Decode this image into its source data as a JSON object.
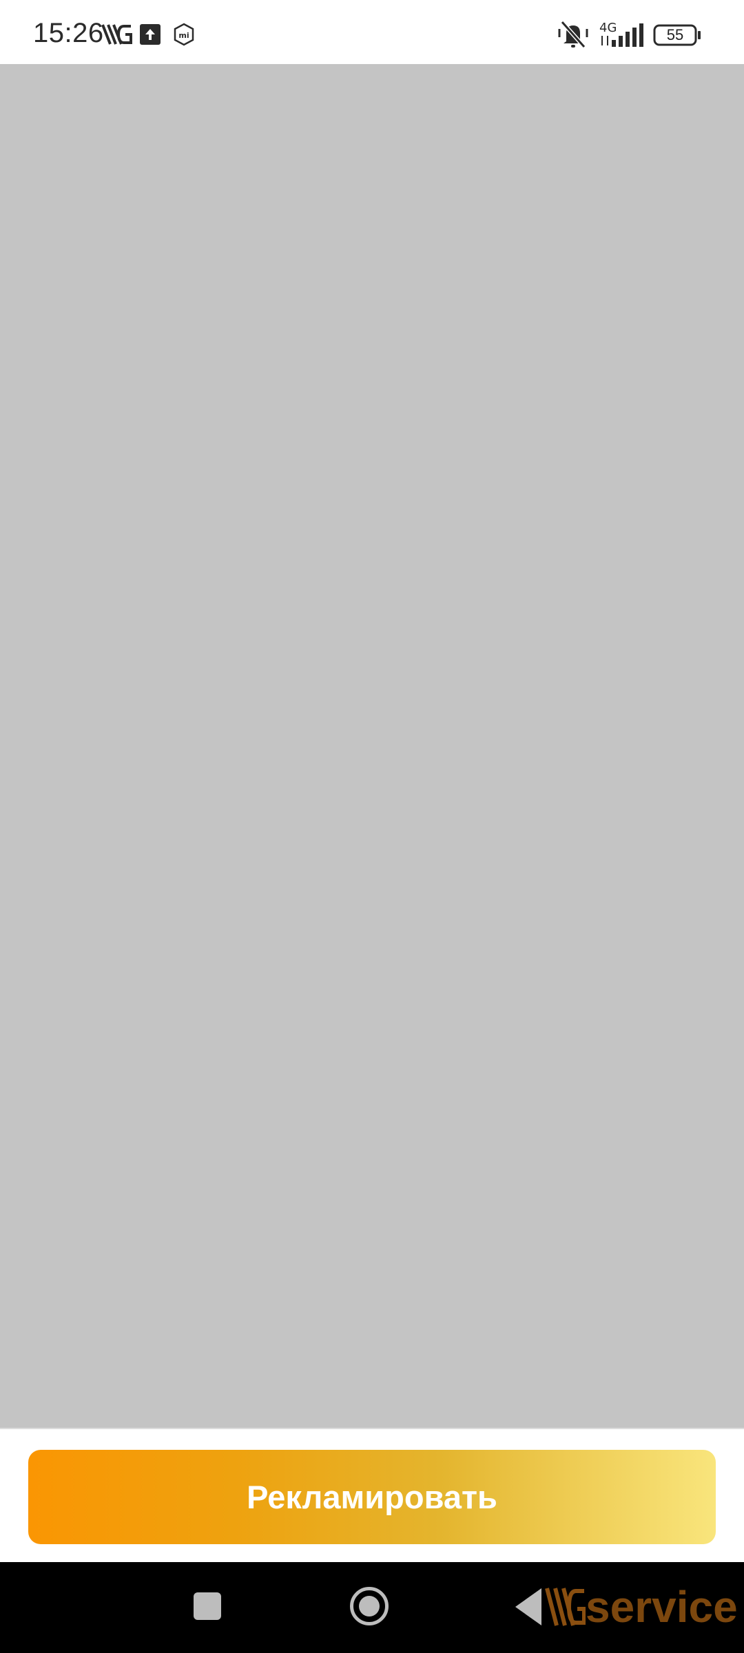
{
  "status_bar": {
    "time": "15:26",
    "network_label": "4G",
    "battery_level": "55",
    "icons": [
      "vk-logo-icon",
      "upload-icon",
      "mi-icon",
      "bell-muted-icon",
      "signal-icon",
      "battery-icon"
    ]
  },
  "main": {
    "button_label": "Рекламировать",
    "button_gradient": [
      "#fa9603",
      "#f9e57c"
    ],
    "content_bg": "#c4c4c4"
  },
  "nav_bar": {
    "icons": [
      "recent-apps-icon",
      "home-icon",
      "back-icon"
    ],
    "watermark": "service"
  }
}
